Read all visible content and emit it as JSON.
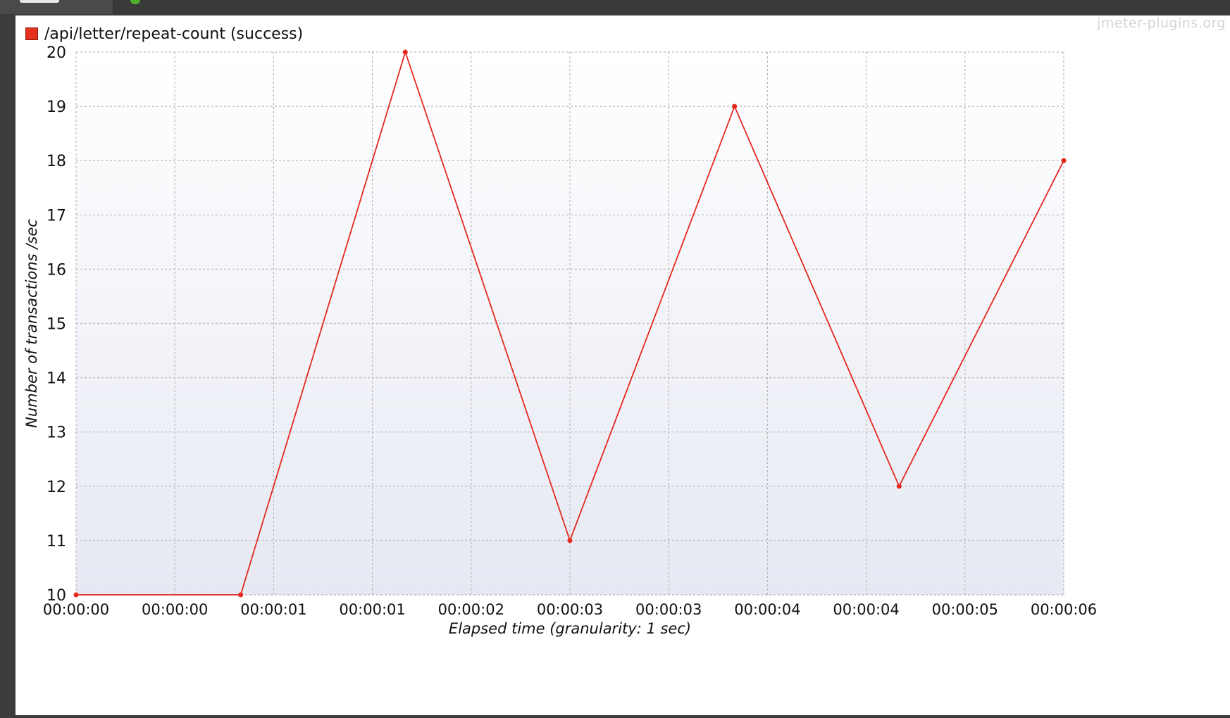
{
  "watermark": "jmeter-plugins.org",
  "chart_data": {
    "type": "line",
    "xlabel": "Elapsed time (granularity: 1 sec)",
    "ylabel": "Number of transactions /sec",
    "ylim": [
      10,
      20
    ],
    "xlim": [
      0,
      6
    ],
    "yticks": [
      10,
      11,
      12,
      13,
      14,
      15,
      16,
      17,
      18,
      19,
      20
    ],
    "xtick_labels": [
      "00:00:00",
      "00:00:00",
      "00:00:01",
      "00:00:01",
      "00:00:02",
      "00:00:03",
      "00:00:03",
      "00:00:04",
      "00:00:04",
      "00:00:05",
      "00:00:06"
    ],
    "grid": true,
    "legend_position": "top-left",
    "series": [
      {
        "name": "/api/letter/repeat-count (success)",
        "color": "#e5281e",
        "x": [
          0,
          1,
          2,
          3,
          4,
          5,
          6
        ],
        "y": [
          10,
          10,
          20,
          11,
          19,
          12,
          18
        ]
      }
    ]
  }
}
